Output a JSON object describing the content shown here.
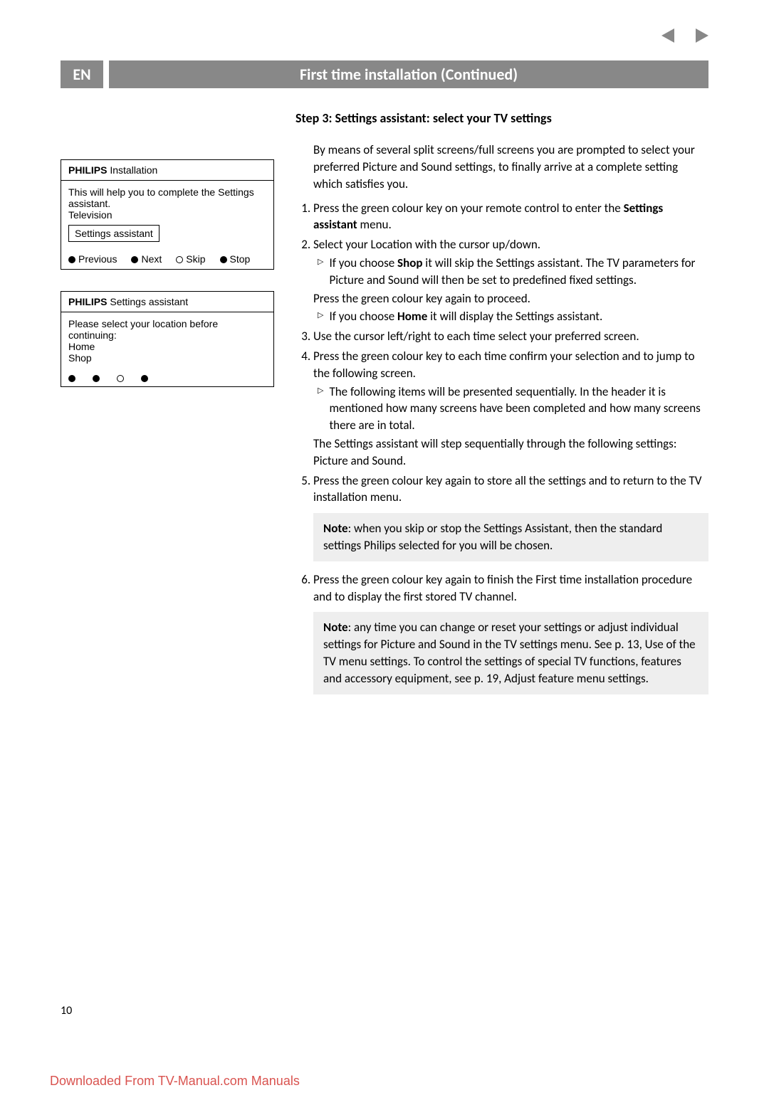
{
  "lang_badge": "EN",
  "page_title": "First time installation  (Continued)",
  "step_title": "Step 3: Settings assistant: select your TV settings",
  "screen1": {
    "brand": "PHILIPS",
    "title": "Installation",
    "body_line1": "This will help you to complete the Settings assistant.",
    "body_line2": "Television",
    "option": "Settings assistant",
    "footer": {
      "prev": "Previous",
      "next": "Next",
      "skip": "Skip",
      "stop": "Stop"
    }
  },
  "screen2": {
    "brand": "PHILIPS",
    "title": "Settings assistant",
    "body_line1": "Please select your location before continuing:",
    "opt1": "Home",
    "opt2": "Shop"
  },
  "intro_text": "By means of several split screens/full screens you are prompted to select your preferred Picture and Sound settings, to finally arrive at a complete setting which satisfies you.",
  "steps": {
    "s1a": "Press the green colour key on your remote control to enter the ",
    "s1b": "Settings assistant",
    "s1c": " menu.",
    "s2": "Select your Location with the cursor up/down.",
    "s2_sub1a": "If you choose ",
    "s2_sub1b": "Shop",
    "s2_sub1c": " it will skip the Settings assistant. The TV parameters for Picture and Sound will then be set to predefined fixed settings.",
    "s2_mid": "Press the green colour key again to proceed.",
    "s2_sub2a": "If you choose ",
    "s2_sub2b": "Home",
    "s2_sub2c": " it will display the Settings assistant.",
    "s3": "Use the cursor left/right to each time select your preferred screen.",
    "s4": "Press the green colour key to each time confirm your selection and to jump to the following screen.",
    "s4_sub1": "The following items will be presented sequentially. In the header it is mentioned how many screens have been completed and how many screens there are in total.",
    "s4_after": "The Settings assistant will step sequentially through the following settings: Picture and Sound.",
    "s5": "Press the green colour key again to store all the settings and to return to the TV installation menu.",
    "s6": "Press the green colour key again to finish the First time installation procedure and to display the first stored TV channel."
  },
  "note1a": "Note",
  "note1b": ": when you skip or stop the Settings Assistant, then the standard settings Philips selected for you will be chosen.",
  "note2a": "Note",
  "note2b": ": any time you can change or reset your settings or adjust individual settings for Picture and Sound in the TV settings menu. See p. 13, Use of the TV menu settings. To control the settings of special TV functions, features and accessory equipment, see p. 19,  Adjust feature menu settings.",
  "page_number": "10",
  "footer_link": "Downloaded From TV-Manual.com Manuals"
}
